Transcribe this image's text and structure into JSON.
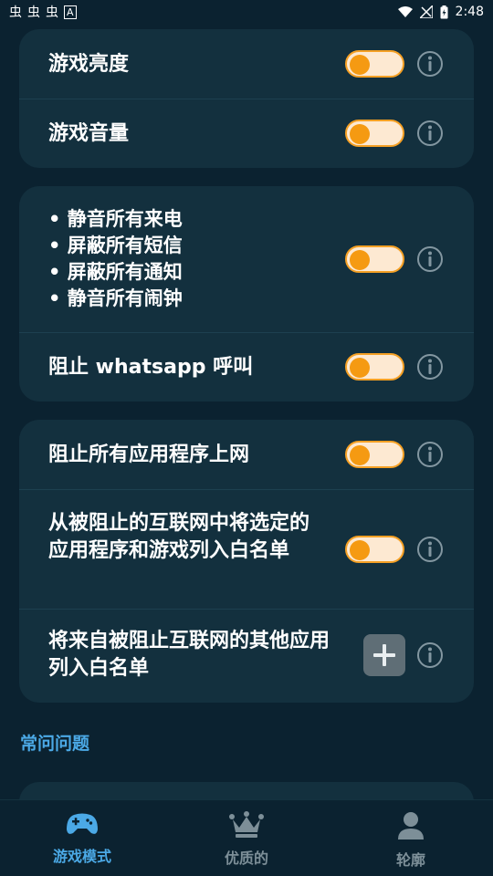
{
  "status_bar": {
    "left_icons": [
      "虫",
      "虫",
      "虫",
      "A"
    ],
    "time": "2:48"
  },
  "settings": {
    "game_brightness": {
      "label": "游戏亮度",
      "enabled": false
    },
    "game_volume": {
      "label": "游戏音量",
      "enabled": false
    },
    "silence_group": {
      "items": [
        "静音所有来电",
        "屏蔽所有短信",
        "屏蔽所有通知",
        "静音所有闹钟"
      ],
      "enabled": false
    },
    "block_whatsapp": {
      "label": "阻止 whatsapp 呼叫",
      "enabled": false
    },
    "block_internet": {
      "label": "阻止所有应用程序上网",
      "enabled": false
    },
    "whitelist_selected": {
      "label": "从被阻止的互联网中将选定的应用程序和游戏列入白名单",
      "enabled": false
    },
    "whitelist_other": {
      "label": "将来自被阻止互联网的其他应用列入白名单"
    }
  },
  "faq": {
    "label": "常问问题"
  },
  "nav": {
    "items": [
      {
        "label": "游戏模式",
        "icon": "gamepad-icon",
        "active": true
      },
      {
        "label": "优质的",
        "icon": "crown-icon",
        "active": false
      },
      {
        "label": "轮廓",
        "icon": "user-icon",
        "active": false
      }
    ]
  },
  "colors": {
    "background": "#0b2230",
    "card": "#13303e",
    "toggle_track": "#fde9d2",
    "toggle_knob": "#f59a12",
    "accent": "#4ba9e6"
  }
}
